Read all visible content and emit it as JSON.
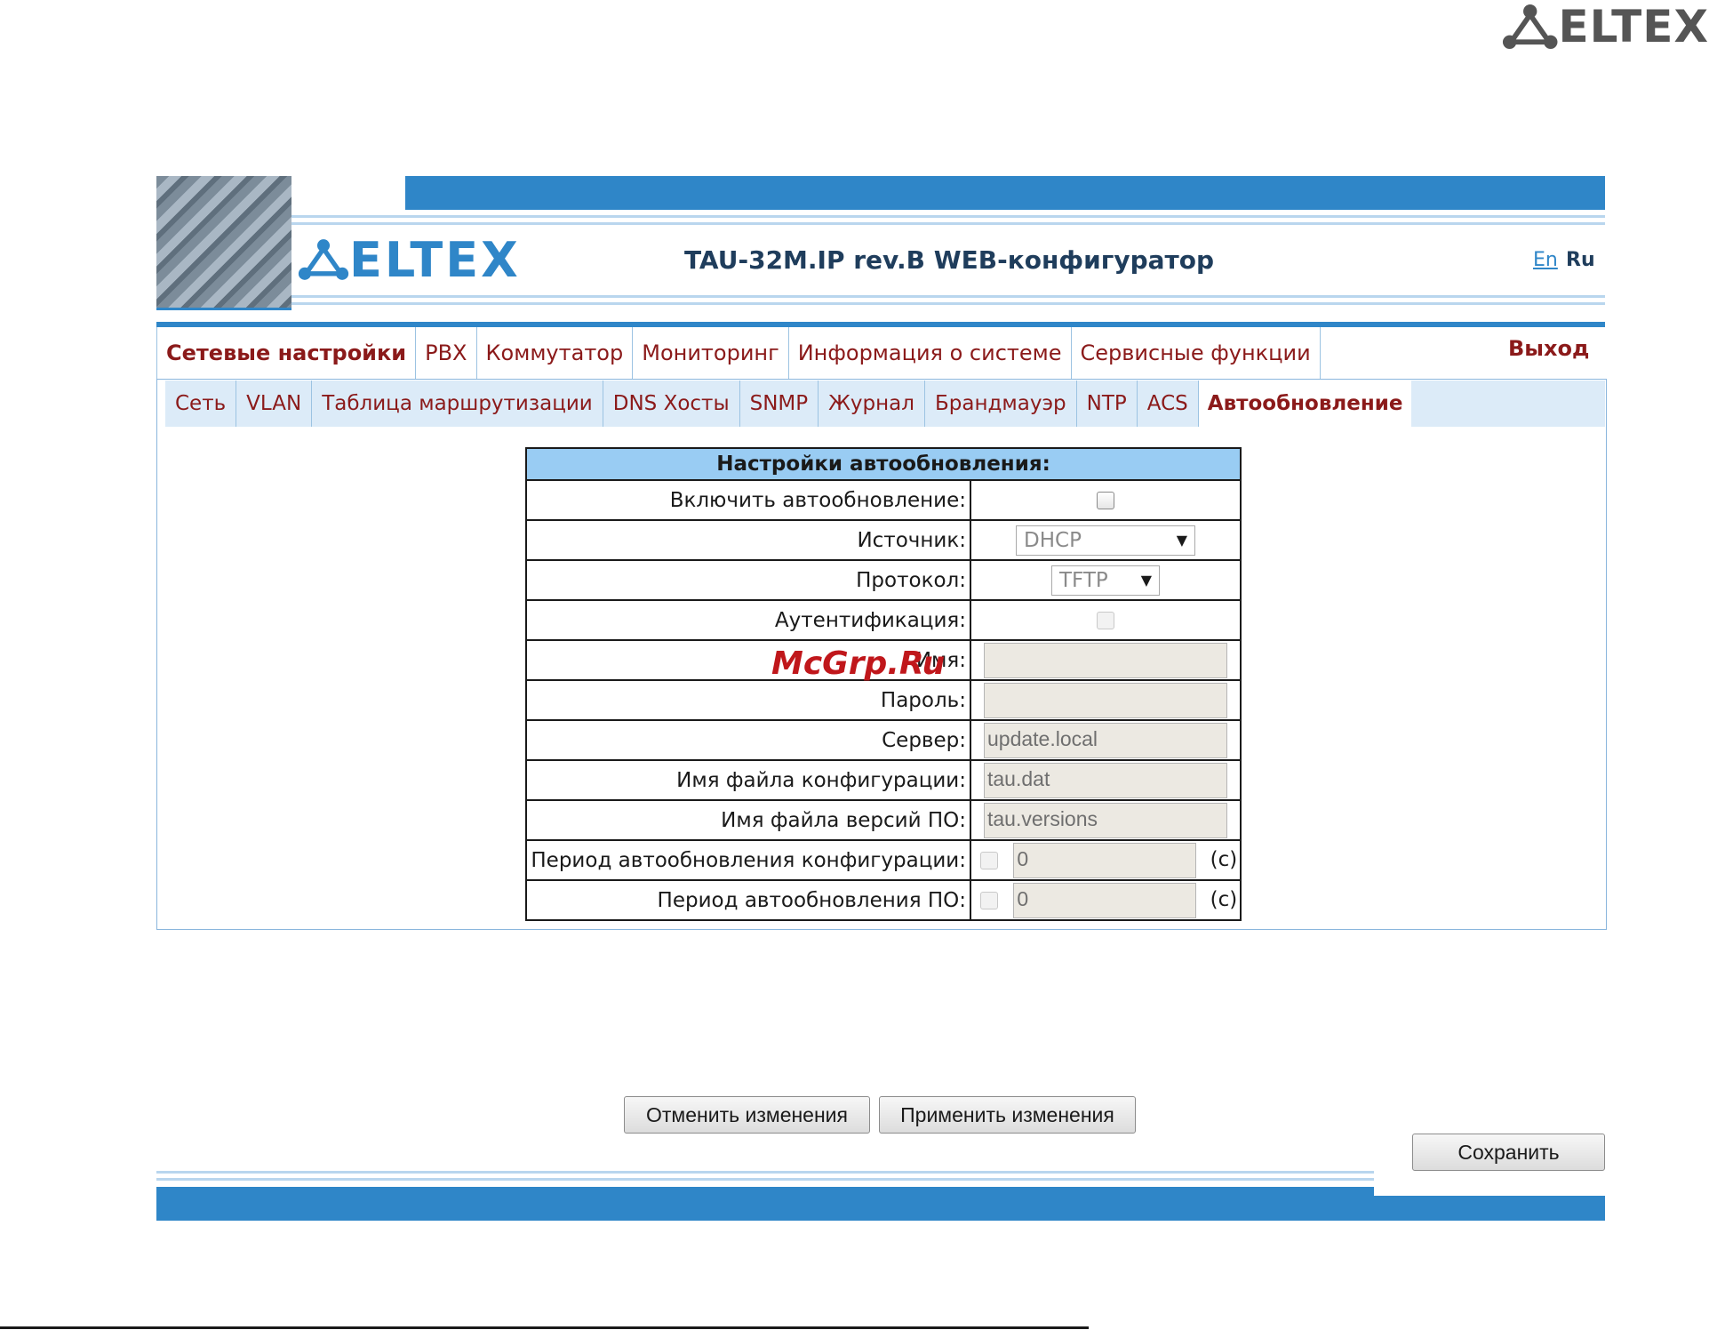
{
  "page_logo": {
    "text": "ELTEX",
    "icon": "eltex-people-icon"
  },
  "header": {
    "logo_text": "ELTEX",
    "title": "TAU-32M.IP rev.B WEB-конфигуратор",
    "lang_en": "En",
    "lang_ru": "Ru"
  },
  "main_nav": {
    "tabs": [
      {
        "label": "Сетевые настройки",
        "active": true
      },
      {
        "label": "PBX"
      },
      {
        "label": "Коммутатор"
      },
      {
        "label": "Мониторинг"
      },
      {
        "label": "Информация о системе"
      },
      {
        "label": "Сервисные функции"
      }
    ],
    "logout": "Выход"
  },
  "sub_nav": {
    "tabs": [
      {
        "label": "Сеть"
      },
      {
        "label": "VLAN"
      },
      {
        "label": "Таблица маршрутизации"
      },
      {
        "label": "DNS Хосты"
      },
      {
        "label": "SNMP"
      },
      {
        "label": "Журнал"
      },
      {
        "label": "Брандмауэр"
      },
      {
        "label": "NTP"
      },
      {
        "label": "ACS"
      },
      {
        "label": "Автообновление",
        "active": true
      }
    ]
  },
  "settings": {
    "header": "Настройки автообновления:",
    "enable_label": "Включить автообновление:",
    "source_label": "Источник:",
    "source_value": "DHCP",
    "protocol_label": "Протокол:",
    "protocol_value": "TFTP",
    "auth_label": "Аутентификация:",
    "name_label": "Имя:",
    "name_value": "",
    "password_label": "Пароль:",
    "password_value": "",
    "server_label": "Сервер:",
    "server_value": "update.local",
    "config_file_label": "Имя файла конфигурации:",
    "config_file_value": "tau.dat",
    "versions_file_label": "Имя файла версий ПО:",
    "versions_file_value": "tau.versions",
    "config_period_label": "Период автообновления конфигурации:",
    "config_period_value": "0",
    "fw_period_label": "Период автообновления ПО:",
    "fw_period_value": "0",
    "unit": "(c)"
  },
  "watermark": "McGrp.Ru",
  "buttons": {
    "cancel": "Отменить изменения",
    "apply": "Применить изменения",
    "save": "Сохранить"
  },
  "colors": {
    "accent": "#2f86c8",
    "link": "#8b1a1a",
    "table_header": "#99ccf3"
  }
}
